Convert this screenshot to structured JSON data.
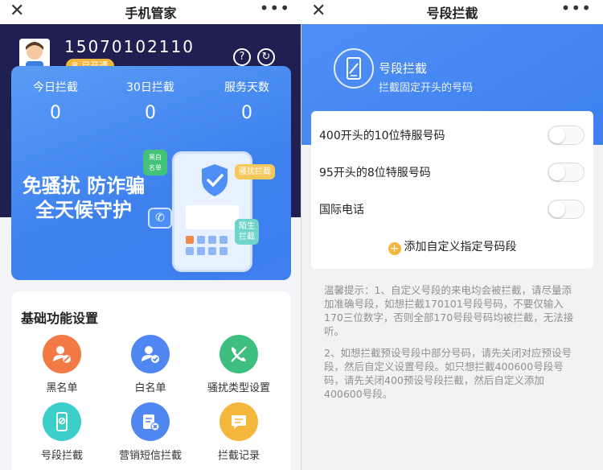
{
  "left": {
    "nav": {
      "title": "手机管家",
      "close": "✕",
      "more": "•••"
    },
    "header": {
      "phone": "15070102110",
      "badge": "已开通",
      "help": "?",
      "refresh": "↻"
    },
    "stats": [
      {
        "label": "今日拦截",
        "value": "0"
      },
      {
        "label": "30日拦截",
        "value": "0"
      },
      {
        "label": "服务天数",
        "value": "0"
      }
    ],
    "slogan": {
      "line1": "免骚扰 防诈骗",
      "line2": "全天候守护"
    },
    "tags": {
      "black": "黑白名单",
      "harass": "骚扰拦截",
      "stranger": "陌生拦截"
    },
    "functions": {
      "title": "基础功能设置",
      "items": [
        {
          "label": "黑名单",
          "color": "#f37a44",
          "icon": "block-user-icon"
        },
        {
          "label": "白名单",
          "color": "#4f86f2",
          "icon": "check-user-icon"
        },
        {
          "label": "骚扰类型设置",
          "color": "#3fbf7f",
          "icon": "phone-block-icon"
        },
        {
          "label": "号段拦截",
          "color": "#3ccfc9",
          "icon": "phone-frame-icon"
        },
        {
          "label": "营销短信拦截",
          "color": "#4f86f2",
          "icon": "sms-block-icon"
        },
        {
          "label": "拦截记录",
          "color": "#f5b63c",
          "icon": "record-icon"
        }
      ]
    }
  },
  "right": {
    "nav": {
      "title": "号段拦截",
      "close": "✕",
      "more": "•••"
    },
    "hero": {
      "title": "号段拦截",
      "subtitle": "拦截固定开头的号码"
    },
    "rows": [
      {
        "label": "400开头的10位特服号码",
        "enabled": false
      },
      {
        "label": "95开头的8位特服号码",
        "enabled": false
      },
      {
        "label": "国际电话",
        "enabled": false
      }
    ],
    "add": {
      "label": "添加自定义指定号码段",
      "icon": "+"
    },
    "tips": [
      "温馨提示：1、自定义号段的来电均会被拦截，请尽量添加准确号段，如想拦截170101号段号码，不要仅输入170三位数字，否则全部170号段号码均被拦截，无法接听。",
      "2、如想拦截预设号段中部分号码，请先关闭对应预设号段，然后自定义设置号段。如只想拦截400600号段号码，请先关闭400预设号段拦截，然后自定义添加400600号段。"
    ]
  }
}
